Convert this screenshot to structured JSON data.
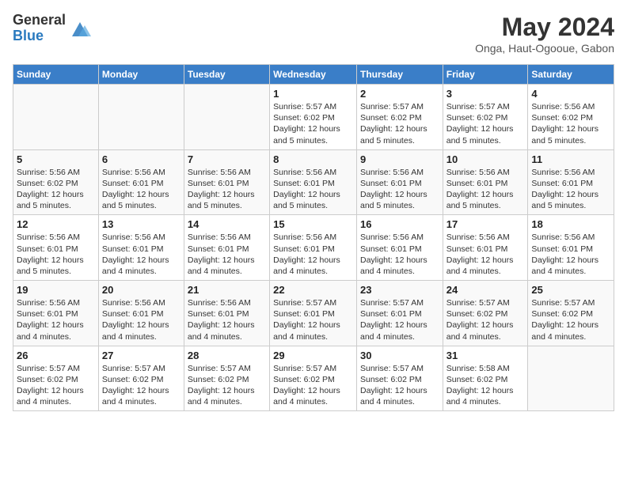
{
  "logo": {
    "general": "General",
    "blue": "Blue"
  },
  "title": "May 2024",
  "subtitle": "Onga, Haut-Ogooue, Gabon",
  "days_header": [
    "Sunday",
    "Monday",
    "Tuesday",
    "Wednesday",
    "Thursday",
    "Friday",
    "Saturday"
  ],
  "weeks": [
    [
      {
        "day": "",
        "info": ""
      },
      {
        "day": "",
        "info": ""
      },
      {
        "day": "",
        "info": ""
      },
      {
        "day": "1",
        "info": "Sunrise: 5:57 AM\nSunset: 6:02 PM\nDaylight: 12 hours\nand 5 minutes."
      },
      {
        "day": "2",
        "info": "Sunrise: 5:57 AM\nSunset: 6:02 PM\nDaylight: 12 hours\nand 5 minutes."
      },
      {
        "day": "3",
        "info": "Sunrise: 5:57 AM\nSunset: 6:02 PM\nDaylight: 12 hours\nand 5 minutes."
      },
      {
        "day": "4",
        "info": "Sunrise: 5:56 AM\nSunset: 6:02 PM\nDaylight: 12 hours\nand 5 minutes."
      }
    ],
    [
      {
        "day": "5",
        "info": "Sunrise: 5:56 AM\nSunset: 6:02 PM\nDaylight: 12 hours\nand 5 minutes."
      },
      {
        "day": "6",
        "info": "Sunrise: 5:56 AM\nSunset: 6:01 PM\nDaylight: 12 hours\nand 5 minutes."
      },
      {
        "day": "7",
        "info": "Sunrise: 5:56 AM\nSunset: 6:01 PM\nDaylight: 12 hours\nand 5 minutes."
      },
      {
        "day": "8",
        "info": "Sunrise: 5:56 AM\nSunset: 6:01 PM\nDaylight: 12 hours\nand 5 minutes."
      },
      {
        "day": "9",
        "info": "Sunrise: 5:56 AM\nSunset: 6:01 PM\nDaylight: 12 hours\nand 5 minutes."
      },
      {
        "day": "10",
        "info": "Sunrise: 5:56 AM\nSunset: 6:01 PM\nDaylight: 12 hours\nand 5 minutes."
      },
      {
        "day": "11",
        "info": "Sunrise: 5:56 AM\nSunset: 6:01 PM\nDaylight: 12 hours\nand 5 minutes."
      }
    ],
    [
      {
        "day": "12",
        "info": "Sunrise: 5:56 AM\nSunset: 6:01 PM\nDaylight: 12 hours\nand 5 minutes."
      },
      {
        "day": "13",
        "info": "Sunrise: 5:56 AM\nSunset: 6:01 PM\nDaylight: 12 hours\nand 4 minutes."
      },
      {
        "day": "14",
        "info": "Sunrise: 5:56 AM\nSunset: 6:01 PM\nDaylight: 12 hours\nand 4 minutes."
      },
      {
        "day": "15",
        "info": "Sunrise: 5:56 AM\nSunset: 6:01 PM\nDaylight: 12 hours\nand 4 minutes."
      },
      {
        "day": "16",
        "info": "Sunrise: 5:56 AM\nSunset: 6:01 PM\nDaylight: 12 hours\nand 4 minutes."
      },
      {
        "day": "17",
        "info": "Sunrise: 5:56 AM\nSunset: 6:01 PM\nDaylight: 12 hours\nand 4 minutes."
      },
      {
        "day": "18",
        "info": "Sunrise: 5:56 AM\nSunset: 6:01 PM\nDaylight: 12 hours\nand 4 minutes."
      }
    ],
    [
      {
        "day": "19",
        "info": "Sunrise: 5:56 AM\nSunset: 6:01 PM\nDaylight: 12 hours\nand 4 minutes."
      },
      {
        "day": "20",
        "info": "Sunrise: 5:56 AM\nSunset: 6:01 PM\nDaylight: 12 hours\nand 4 minutes."
      },
      {
        "day": "21",
        "info": "Sunrise: 5:56 AM\nSunset: 6:01 PM\nDaylight: 12 hours\nand 4 minutes."
      },
      {
        "day": "22",
        "info": "Sunrise: 5:57 AM\nSunset: 6:01 PM\nDaylight: 12 hours\nand 4 minutes."
      },
      {
        "day": "23",
        "info": "Sunrise: 5:57 AM\nSunset: 6:01 PM\nDaylight: 12 hours\nand 4 minutes."
      },
      {
        "day": "24",
        "info": "Sunrise: 5:57 AM\nSunset: 6:02 PM\nDaylight: 12 hours\nand 4 minutes."
      },
      {
        "day": "25",
        "info": "Sunrise: 5:57 AM\nSunset: 6:02 PM\nDaylight: 12 hours\nand 4 minutes."
      }
    ],
    [
      {
        "day": "26",
        "info": "Sunrise: 5:57 AM\nSunset: 6:02 PM\nDaylight: 12 hours\nand 4 minutes."
      },
      {
        "day": "27",
        "info": "Sunrise: 5:57 AM\nSunset: 6:02 PM\nDaylight: 12 hours\nand 4 minutes."
      },
      {
        "day": "28",
        "info": "Sunrise: 5:57 AM\nSunset: 6:02 PM\nDaylight: 12 hours\nand 4 minutes."
      },
      {
        "day": "29",
        "info": "Sunrise: 5:57 AM\nSunset: 6:02 PM\nDaylight: 12 hours\nand 4 minutes."
      },
      {
        "day": "30",
        "info": "Sunrise: 5:57 AM\nSunset: 6:02 PM\nDaylight: 12 hours\nand 4 minutes."
      },
      {
        "day": "31",
        "info": "Sunrise: 5:58 AM\nSunset: 6:02 PM\nDaylight: 12 hours\nand 4 minutes."
      },
      {
        "day": "",
        "info": ""
      }
    ]
  ]
}
